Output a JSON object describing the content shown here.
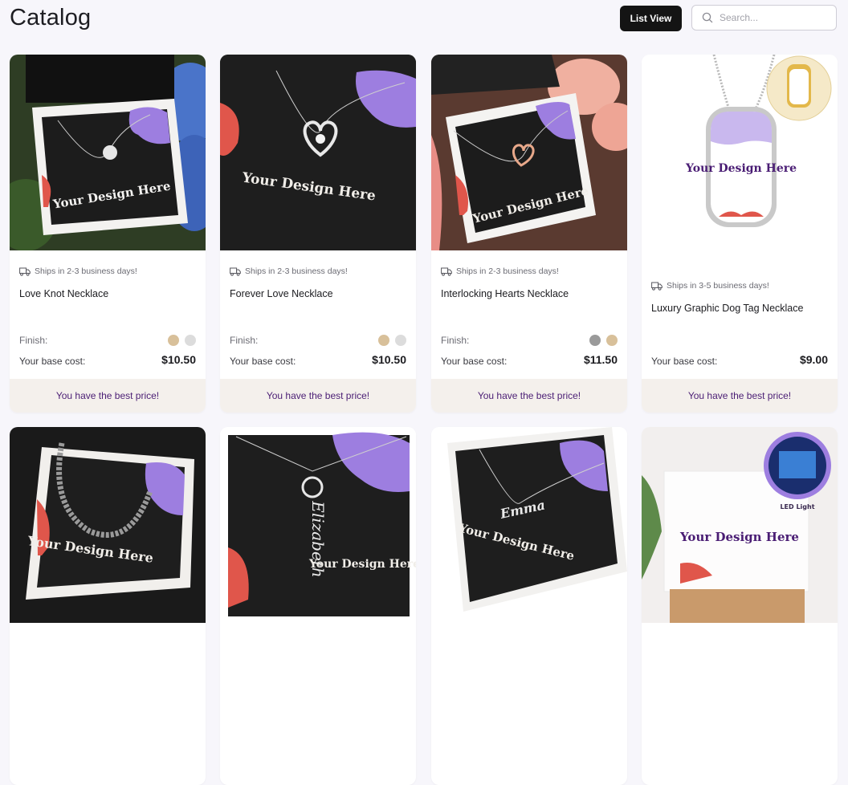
{
  "header": {
    "title": "Catalog",
    "list_view_label": "List View",
    "search_placeholder": "Search..."
  },
  "colors": {
    "accent_purple": "#4a1d74",
    "best_price_bg": "#f4f0ec",
    "button_dark": "#141414"
  },
  "products": [
    {
      "ship": "Ships in 2-3 business days!",
      "name": "Love Knot Necklace",
      "finish_label": "Finish:",
      "finishes": [
        "#d8c09a",
        "#dcdcdc"
      ],
      "cost_label": "Your base cost:",
      "cost": "$10.50",
      "best_price": "You have the best price!",
      "image_text": "Your Design Here"
    },
    {
      "ship": "Ships in 2-3 business days!",
      "name": "Forever Love Necklace",
      "finish_label": "Finish:",
      "finishes": [
        "#d8c09a",
        "#dcdcdc"
      ],
      "cost_label": "Your base cost:",
      "cost": "$10.50",
      "best_price": "You have the best price!",
      "image_text": "Your Design Here"
    },
    {
      "ship": "Ships in 2-3 business days!",
      "name": "Interlocking Hearts Necklace",
      "finish_label": "Finish:",
      "finishes": [
        "#9a9a9a",
        "#d8c09a"
      ],
      "cost_label": "Your base cost:",
      "cost": "$11.50",
      "best_price": "You have the best price!",
      "image_text": "Your Design Here"
    },
    {
      "ship": "Ships in 3-5 business days!",
      "name": "Luxury Graphic Dog Tag Necklace",
      "finish_label": "",
      "finishes": [],
      "cost_label": "Your base cost:",
      "cost": "$9.00",
      "best_price": "You have the best price!",
      "image_text": "Your Design Here"
    }
  ],
  "row2_images": [
    {
      "image_text": "Your Design Here"
    },
    {
      "image_text": "Your Design Here",
      "script_name": "Elizabeth"
    },
    {
      "image_text": "Your Design Here",
      "script_name": "Emma"
    },
    {
      "image_text": "Your Design Here",
      "badge": "LED Light"
    }
  ]
}
